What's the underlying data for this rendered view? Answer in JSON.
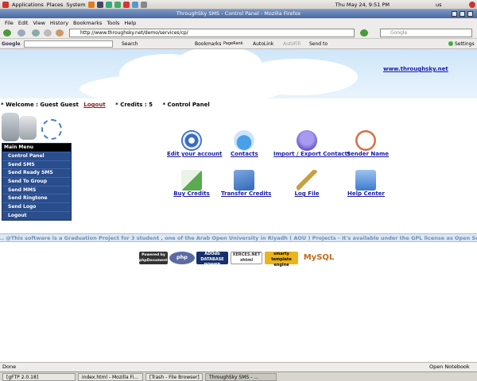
{
  "panel": {
    "applications": "Applications",
    "places": "Places",
    "system": "System",
    "clock": "Thu May 24,  9:51 PM",
    "locale": "us"
  },
  "window": {
    "title": "ThroughSky SMS - Control Panel - Mozilla Firefox"
  },
  "menubar": [
    "File",
    "Edit",
    "View",
    "History",
    "Bookmarks",
    "Tools",
    "Help"
  ],
  "nav": {
    "url": "http://www.throughsky.net/demo/services/cp/",
    "search_placeholder": "Google"
  },
  "gtoolbar": {
    "brand": "Google",
    "search": "Search",
    "bookmarks": "Bookmarks",
    "pagerank": "PageRank",
    "autolink": "AutoLink",
    "autofill": "AutoFill",
    "sendto": "Send to",
    "settings": "Settings"
  },
  "page": {
    "site_link": "www.throughsky.net",
    "welcome": {
      "prefix": "* Welcome :  Guest Guest",
      "logout": "Logout",
      "credits": "* Credits : 5",
      "cp": "* Control Panel"
    },
    "main_menu": {
      "header": "Main Menu",
      "items": [
        "Control Panel",
        "Send SMS",
        "Send Ready SMS",
        "Send To Group",
        "Send MMS",
        "Send Ringtone",
        "Send Logo",
        "Logout"
      ]
    },
    "actions": [
      {
        "label": "Edit your account",
        "icon": "target-icon",
        "color": "#3b6cc4"
      },
      {
        "label": "Contacts",
        "icon": "flask-icon",
        "color": "#4aa0e8"
      },
      {
        "label": "Import / Export Contacts",
        "icon": "lightbulb-icon",
        "color": "#6a5bc9"
      },
      {
        "label": "Sender Name",
        "icon": "clock-icon",
        "color": "#d8704a"
      },
      {
        "label": "Buy Credits",
        "icon": "envelope-icon",
        "color": "#5aaa50"
      },
      {
        "label": "Transfer Credits",
        "icon": "books-icon",
        "color": "#2f68b8"
      },
      {
        "label": "Log File",
        "icon": "pencil-icon",
        "color": "#c8a040"
      },
      {
        "label": "Help Center",
        "icon": "help-icon",
        "color": "#3d7ad0"
      }
    ],
    "ticker": ".. @This software is a Graduation Project for 3 student , one of the Arab Open University in Riyadh ( AOU ) Projects - It's available under the GPL license as Open Source Software.",
    "badges": [
      "Powered by phpDocumentor",
      "php",
      "ADOdb DATABASE POWER",
      "XERCES.NET xhtml",
      "smarty template engine",
      "MySQL"
    ]
  },
  "status": {
    "text": "Done",
    "notebook": "Open Notebook"
  },
  "taskbar": [
    "[gFTP 2.0.18]",
    "index.html - Mozilla Fi...",
    "[Trash - File Browser]",
    "ThroughSky SMS - ..."
  ]
}
